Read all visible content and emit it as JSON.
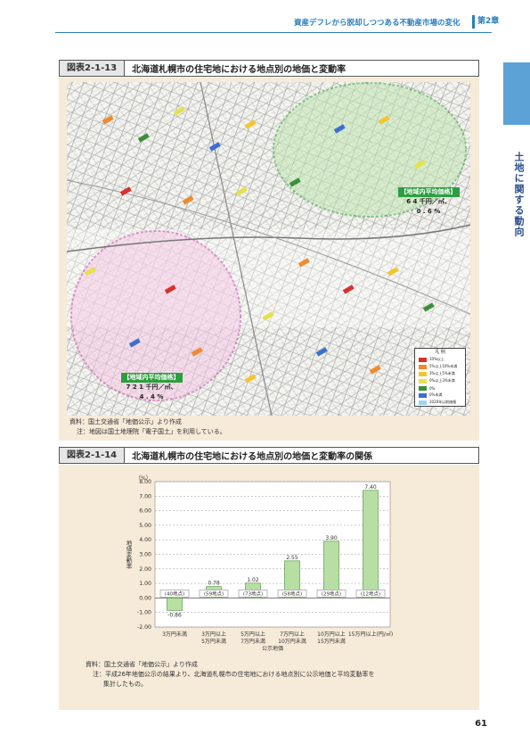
{
  "header": {
    "title": "資産デフレから脱却しつつある不動産市場の変化",
    "chapter": "第2章"
  },
  "side_tab": {
    "text": "土地に関する動向"
  },
  "figure1": {
    "number": "図表2-1-13",
    "title": "北海道札幌市の住宅地における地点別の地価と変動率",
    "labels": [
      {
        "line1": "【地域内平均価格】",
        "line2": "6 4 千円／㎡、",
        "line3": "0 . 6 %"
      },
      {
        "line1": "【地域内平均価格】",
        "line2": "7 2 1 千円／㎡、",
        "line3": "4 . 4 %"
      }
    ],
    "legend": {
      "title": "凡 例",
      "items": [
        {
          "label": "10%以上",
          "color": "#d9302b"
        },
        {
          "label": "5%以上10%未満",
          "color": "#f08a2c"
        },
        {
          "label": "3%以上5%未満",
          "color": "#f4c531"
        },
        {
          "label": "0%以上3%未満",
          "color": "#e6e04a"
        },
        {
          "label": "0%",
          "color": "#3c8f3a"
        },
        {
          "label": "0%未満",
          "color": "#3c6fd0"
        },
        {
          "label": "2020年以前価格",
          "color": "#9fd6ef"
        }
      ]
    },
    "source": "資料：国土交通省「地価公示」より作成",
    "note": "注：地図は国土地理院「電子国土」を利用している。"
  },
  "figure2": {
    "number": "図表2-1-14",
    "title": "北海道札幌市の住宅地における地点別の地価と変動率の関係",
    "source": "資料：国土交通省「地価公示」より作成",
    "note_line1": "注：平成26年地価公示の結果より、北海道札幌市の住宅地における地点別に公示地価と平均変動率を",
    "note_line2": "集計したもの。"
  },
  "chart_data": {
    "type": "bar",
    "unit": "（%）",
    "ylabel": "地価変動率",
    "xlabel": "公示地価",
    "categories": [
      [
        "3万円未満"
      ],
      [
        "3万円以上",
        "5万円未満"
      ],
      [
        "5万円以上",
        "7万円未満"
      ],
      [
        "7万円以上",
        "10万円未満"
      ],
      [
        "10万円以上",
        "15万円未満"
      ],
      [
        "15万円以上(円/㎡)"
      ]
    ],
    "values": [
      -0.86,
      0.78,
      1.02,
      2.55,
      3.9,
      7.4
    ],
    "value_labels": [
      "-0.86",
      "0.78",
      "1.02",
      "2.55",
      "3.90",
      "7.40"
    ],
    "counts": [
      "(40地点)",
      "(59地点)",
      "(73地点)",
      "(58地点)",
      "(29地点)",
      "(12地点)"
    ],
    "ylim": [
      -2.0,
      8.0
    ],
    "yticks": [
      "8.00",
      "7.00",
      "6.00",
      "5.00",
      "4.00",
      "3.00",
      "2.00",
      "1.00",
      "0.00",
      "-1.00",
      "-2.00"
    ],
    "grid": true,
    "bar_color": "#b7dfa3"
  },
  "page_number": "61"
}
